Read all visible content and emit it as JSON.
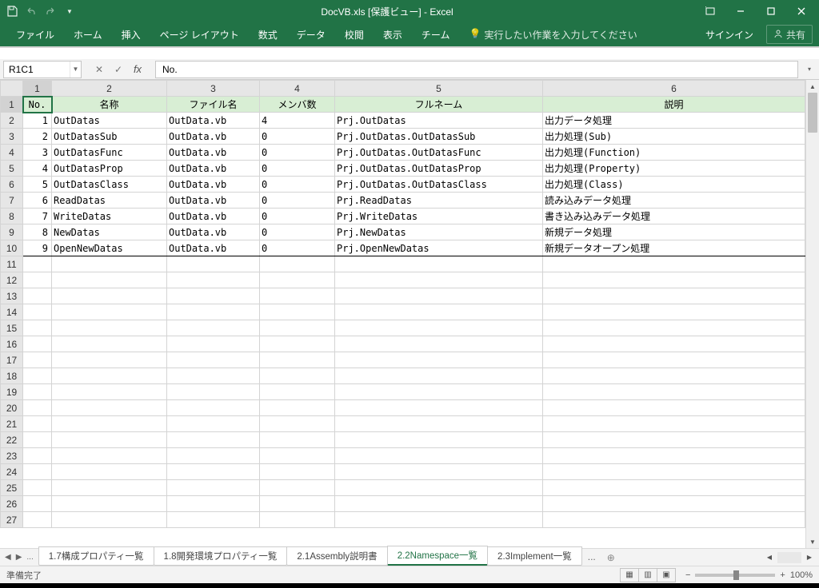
{
  "titlebar": {
    "title": "DocVB.xls  [保護ビュー] - Excel"
  },
  "ribbon": {
    "tabs": [
      "ファイル",
      "ホーム",
      "挿入",
      "ページ レイアウト",
      "数式",
      "データ",
      "校閲",
      "表示",
      "チーム"
    ],
    "tellme": "実行したい作業を入力してください",
    "signin": "サインイン",
    "share": "共有"
  },
  "formula": {
    "name_box": "R1C1",
    "value": "No."
  },
  "cols": [
    "1",
    "2",
    "3",
    "4",
    "5",
    "6"
  ],
  "headers": {
    "c1": "No.",
    "c2": "名称",
    "c3": "ファイル名",
    "c4": "メンバ数",
    "c5": "フルネーム",
    "c6": "説明"
  },
  "rows": [
    {
      "no": "1",
      "name": "OutDatas",
      "file": "OutData.vb",
      "members": "4",
      "full": "Prj.OutDatas",
      "desc": "出力データ処理"
    },
    {
      "no": "2",
      "name": "OutDatasSub",
      "file": "OutData.vb",
      "members": "0",
      "full": "Prj.OutDatas.OutDatasSub",
      "desc": "出力処理(Sub)"
    },
    {
      "no": "3",
      "name": "OutDatasFunc",
      "file": "OutData.vb",
      "members": "0",
      "full": "Prj.OutDatas.OutDatasFunc",
      "desc": "出力処理(Function)"
    },
    {
      "no": "4",
      "name": "OutDatasProp",
      "file": "OutData.vb",
      "members": "0",
      "full": "Prj.OutDatas.OutDatasProp",
      "desc": "出力処理(Property)"
    },
    {
      "no": "5",
      "name": "OutDatasClass",
      "file": "OutData.vb",
      "members": "0",
      "full": "Prj.OutDatas.OutDatasClass",
      "desc": "出力処理(Class)"
    },
    {
      "no": "6",
      "name": "ReadDatas",
      "file": "OutData.vb",
      "members": "0",
      "full": "Prj.ReadDatas",
      "desc": "読み込みデータ処理"
    },
    {
      "no": "7",
      "name": "WriteDatas",
      "file": "OutData.vb",
      "members": "0",
      "full": "Prj.WriteDatas",
      "desc": "書き込み込みデータ処理"
    },
    {
      "no": "8",
      "name": "NewDatas",
      "file": "OutData.vb",
      "members": "0",
      "full": "Prj.NewDatas",
      "desc": "新規データ処理"
    },
    {
      "no": "9",
      "name": "OpenNewDatas",
      "file": "OutData.vb",
      "members": "0",
      "full": "Prj.OpenNewDatas",
      "desc": "新規データオープン処理"
    }
  ],
  "row_labels": [
    "1",
    "2",
    "3",
    "4",
    "5",
    "6",
    "7",
    "8",
    "9",
    "10",
    "11",
    "12",
    "13",
    "14",
    "15",
    "16",
    "17",
    "18",
    "19",
    "20",
    "21",
    "22",
    "23",
    "24",
    "25",
    "26",
    "27"
  ],
  "sheets": {
    "more": "...",
    "tabs": [
      {
        "label": "1.7構成プロパティ一覧",
        "active": false
      },
      {
        "label": "1.8開発環境プロパティ一覧",
        "active": false
      },
      {
        "label": "2.1Assembly説明書",
        "active": false
      },
      {
        "label": "2.2Namespace一覧",
        "active": true
      },
      {
        "label": "2.3Implement一覧",
        "active": false
      }
    ]
  },
  "status": {
    "ready": "準備完了",
    "zoom": "100%"
  }
}
